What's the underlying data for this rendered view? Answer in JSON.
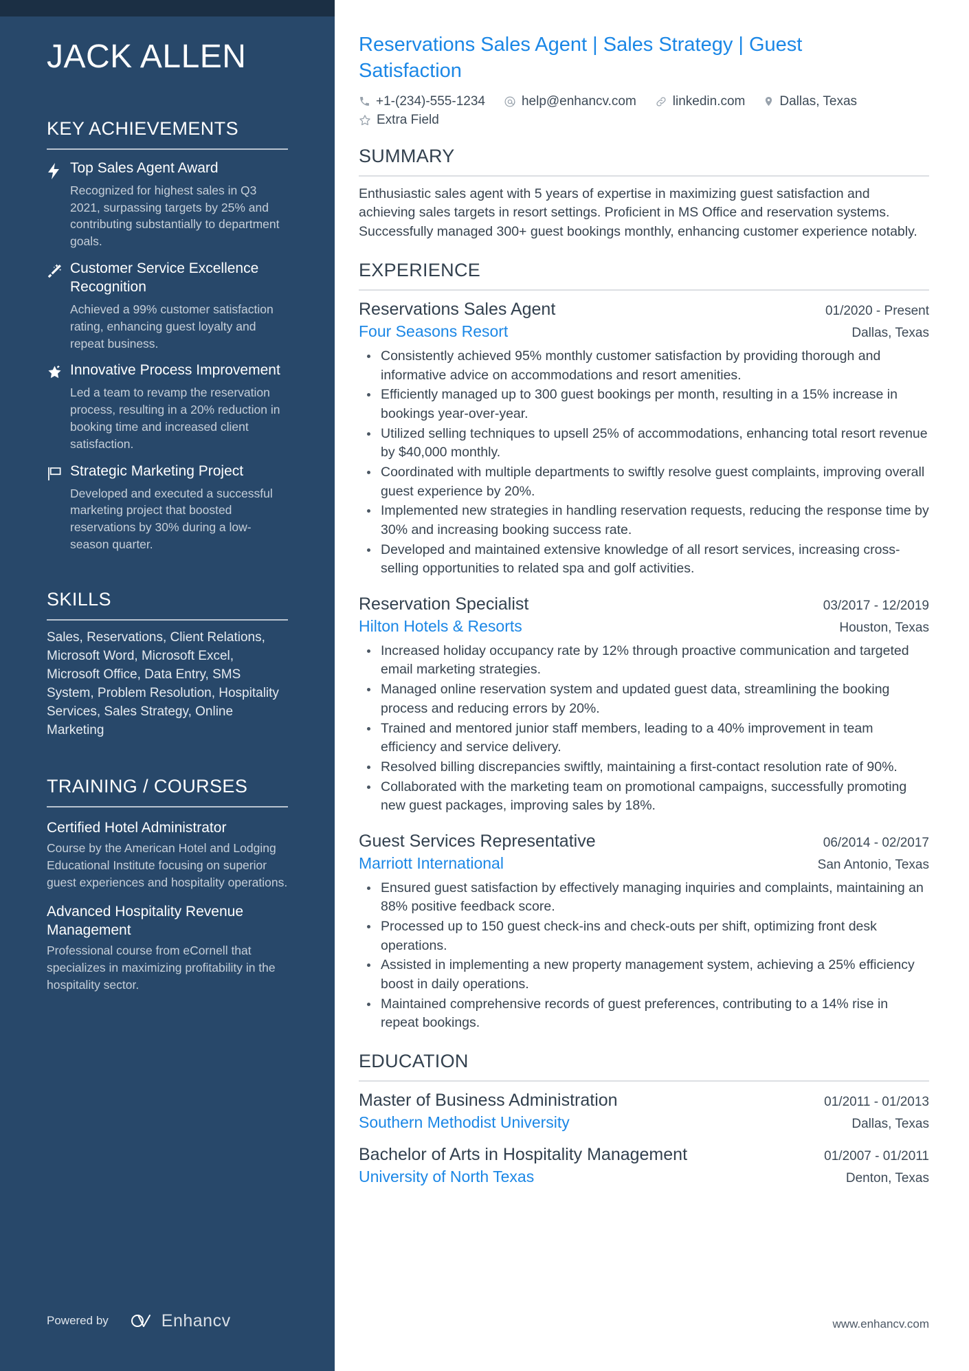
{
  "sidebar": {
    "name": "JACK ALLEN",
    "key_achievements": {
      "heading": "KEY ACHIEVEMENTS",
      "items": [
        {
          "icon": "lightning-bolt-icon",
          "title": "Top Sales Agent Award",
          "description": "Recognized for highest sales in Q3 2021, surpassing targets by 25% and contributing substantially to department goals."
        },
        {
          "icon": "magic-wand-icon",
          "title": "Customer Service Excellence Recognition",
          "description": "Achieved a 99% customer satisfaction rating, enhancing guest loyalty and repeat business."
        },
        {
          "icon": "shooting-star-icon",
          "title": "Innovative Process Improvement",
          "description": "Led a team to revamp the reservation process, resulting in a 20% reduction in booking time and increased client satisfaction."
        },
        {
          "icon": "flag-icon",
          "title": "Strategic Marketing Project",
          "description": "Developed and executed a successful marketing project that boosted reservations by 30% during a low-season quarter."
        }
      ]
    },
    "skills": {
      "heading": "SKILLS",
      "text": "Sales, Reservations, Client Relations, Microsoft Word, Microsoft Excel, Microsoft Office, Data Entry, SMS System, Problem Resolution, Hospitality Services, Sales Strategy, Online Marketing"
    },
    "training": {
      "heading": "TRAINING / COURSES",
      "items": [
        {
          "title": "Certified Hotel Administrator",
          "description": "Course by the American Hotel and Lodging Educational Institute focusing on superior guest experiences and hospitality operations."
        },
        {
          "title": "Advanced Hospitality Revenue Management",
          "description": "Professional course from eCornell that specializes in maximizing profitability in the hospitality sector."
        }
      ]
    },
    "footer": {
      "powered_by": "Powered by",
      "brand": "Enhancv"
    }
  },
  "main": {
    "job_title": "Reservations Sales Agent | Sales Strategy | Guest Satisfaction",
    "contact": [
      {
        "icon": "phone-icon",
        "value": "+1-(234)-555-1234"
      },
      {
        "icon": "at-email-icon",
        "value": "help@enhancv.com"
      },
      {
        "icon": "link-icon",
        "value": "linkedin.com"
      },
      {
        "icon": "location-pin-icon",
        "value": "Dallas, Texas"
      },
      {
        "icon": "star-outline-icon",
        "value": "Extra Field"
      }
    ],
    "summary": {
      "heading": "SUMMARY",
      "text": "Enthusiastic sales agent with 5 years of expertise in maximizing guest satisfaction and achieving sales targets in resort settings. Proficient in MS Office and reservation systems. Successfully managed 300+ guest bookings monthly, enhancing customer experience notably."
    },
    "experience": {
      "heading": "EXPERIENCE",
      "entries": [
        {
          "role": "Reservations Sales Agent",
          "date": "01/2020 - Present",
          "organization": "Four Seasons Resort",
          "location": "Dallas, Texas",
          "bullets": [
            "Consistently achieved 95% monthly customer satisfaction by providing thorough and informative advice on accommodations and resort amenities.",
            "Efficiently managed up to 300 guest bookings per month, resulting in a 15% increase in bookings year-over-year.",
            "Utilized selling techniques to upsell 25% of accommodations, enhancing total resort revenue by $40,000 monthly.",
            "Coordinated with multiple departments to swiftly resolve guest complaints, improving overall guest experience by 20%.",
            "Implemented new strategies in handling reservation requests, reducing the response time by 30% and increasing booking success rate.",
            "Developed and maintained extensive knowledge of all resort services, increasing cross-selling opportunities to related spa and golf activities."
          ]
        },
        {
          "role": "Reservation Specialist",
          "date": "03/2017 - 12/2019",
          "organization": "Hilton Hotels & Resorts",
          "location": "Houston, Texas",
          "bullets": [
            "Increased holiday occupancy rate by 12% through proactive communication and targeted email marketing strategies.",
            "Managed online reservation system and updated guest data, streamlining the booking process and reducing errors by 20%.",
            "Trained and mentored junior staff members, leading to a 40% improvement in team efficiency and service delivery.",
            "Resolved billing discrepancies swiftly, maintaining a first-contact resolution rate of 90%.",
            "Collaborated with the marketing team on promotional campaigns, successfully promoting new guest packages, improving sales by 18%."
          ]
        },
        {
          "role": "Guest Services Representative",
          "date": "06/2014 - 02/2017",
          "organization": "Marriott International",
          "location": "San Antonio, Texas",
          "bullets": [
            "Ensured guest satisfaction by effectively managing inquiries and complaints, maintaining an 88% positive feedback score.",
            "Processed up to 150 guest check-ins and check-outs per shift, optimizing front desk operations.",
            "Assisted in implementing a new property management system, achieving a 25% efficiency boost in daily operations.",
            "Maintained comprehensive records of guest preferences, contributing to a 14% rise in repeat bookings."
          ]
        }
      ]
    },
    "education": {
      "heading": "EDUCATION",
      "entries": [
        {
          "degree": "Master of Business Administration",
          "date": "01/2011 - 01/2013",
          "school": "Southern Methodist University",
          "location": "Dallas, Texas"
        },
        {
          "degree": "Bachelor of Arts in Hospitality Management",
          "date": "01/2007 - 01/2011",
          "school": "University of North Texas",
          "location": "Denton, Texas"
        }
      ]
    },
    "site_url": "www.enhancv.com"
  },
  "colors": {
    "sidebar_bg": "#28486a",
    "sidebar_top_strip": "#1b2f44",
    "accent_blue": "#1b87e6",
    "body_text": "#37434f"
  }
}
